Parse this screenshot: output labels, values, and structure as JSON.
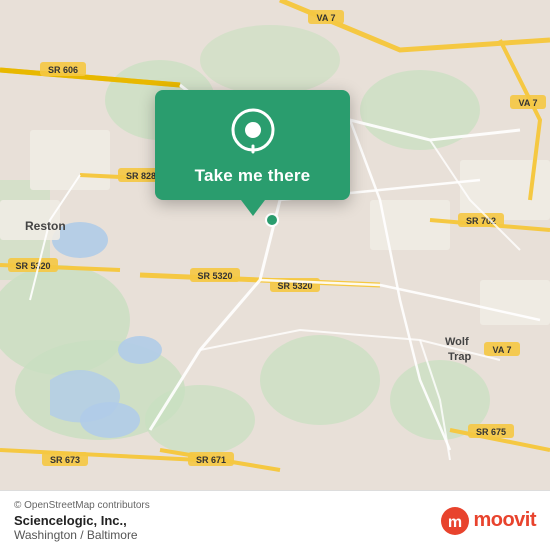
{
  "map": {
    "attribution": "© OpenStreetMap contributors",
    "background_color": "#e8e0d8"
  },
  "popup": {
    "label": "Take me there",
    "pin_color": "#ffffff",
    "bg_color": "#2a9d6e"
  },
  "footer": {
    "company_name": "Sciencelogic, Inc.,",
    "company_location": "Washington / Baltimore",
    "moovit_label": "moovit"
  },
  "road_labels": [
    "SR 606",
    "VA 7",
    "VA 7",
    "SR 606",
    "SR 828",
    "SR 702",
    "VA 7",
    "SR 5320",
    "SR 5320",
    "SR 5320",
    "SR 675",
    "SR 673",
    "SR 671"
  ],
  "place_labels": [
    "Reston",
    "Wolf Trap"
  ]
}
